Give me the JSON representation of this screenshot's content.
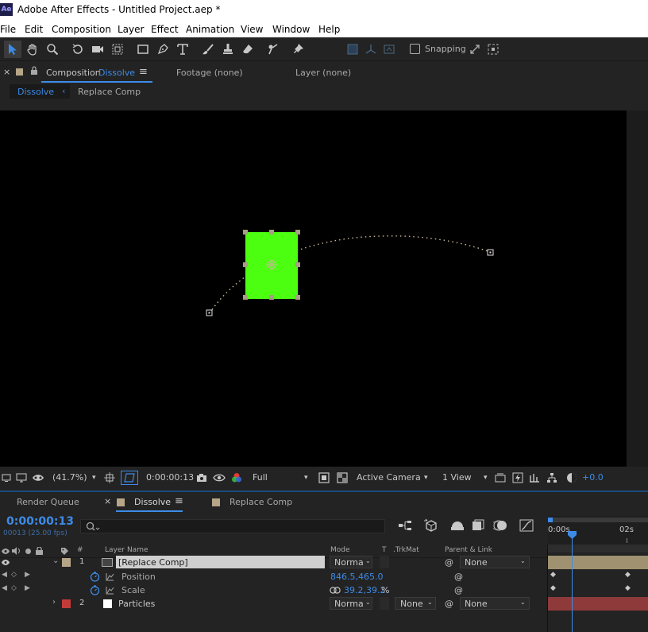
{
  "window": {
    "app_icon": "Ae",
    "title": "Adobe After Effects - Untitled Project.aep *"
  },
  "menu": [
    "File",
    "Edit",
    "Composition",
    "Layer",
    "Effect",
    "Animation",
    "View",
    "Window",
    "Help"
  ],
  "toolbar": {
    "snapping_label": "Snapping"
  },
  "comp_panel": {
    "close": "×",
    "composition_prefix": "Composition",
    "composition_name": "Dissolve",
    "menu_icon": "≡",
    "footage_tab": "Footage  (none)",
    "layer_tab": "Layer  (none)",
    "subtab_active": "Dissolve",
    "subtab_arrow": "‹",
    "subtab_other": "Replace Comp"
  },
  "viewer_controls": {
    "zoom": "(41.7%)",
    "timecode": "0:00:00:13",
    "resolution": "Full",
    "camera": "Active Camera",
    "views": "1 View",
    "exposure": "+0.0"
  },
  "timeline_tabs": {
    "render_queue": "Render Queue",
    "close": "×",
    "dissolve": "Dissolve",
    "menu_icon": "≡",
    "replace_comp": "Replace Comp"
  },
  "timeline": {
    "current_time": "0:00:00:13",
    "frame_info": "00013 (25.00 fps)",
    "search_placeholder": "",
    "col_num": "#",
    "col_layer_name": "Layer Name",
    "col_mode": "Mode",
    "col_t": "T",
    "col_trkmat": ".TrkMat",
    "col_parent": "Parent & Link",
    "ruler_start": "0:00s",
    "ruler_2s": "02s",
    "layers": [
      {
        "num": "1",
        "name": "[Replace Comp]",
        "mode": "Norma",
        "parent": "None",
        "label_color": "#b7a588"
      },
      {
        "num": "2",
        "name": "Particles",
        "mode": "Norma",
        "trkmat": "None",
        "parent": "None",
        "label_color": "#c23b3b"
      }
    ],
    "props": [
      {
        "name": "Position",
        "value": "846.5,465.0"
      },
      {
        "name": "Scale",
        "value": "39.2,39.2",
        "unit": "%"
      }
    ]
  },
  "colors": {
    "accent": "#3d8be8",
    "solid_layer": "#4cff10",
    "particles_track": "#8e3a3a",
    "replace_track": "#a09270"
  }
}
